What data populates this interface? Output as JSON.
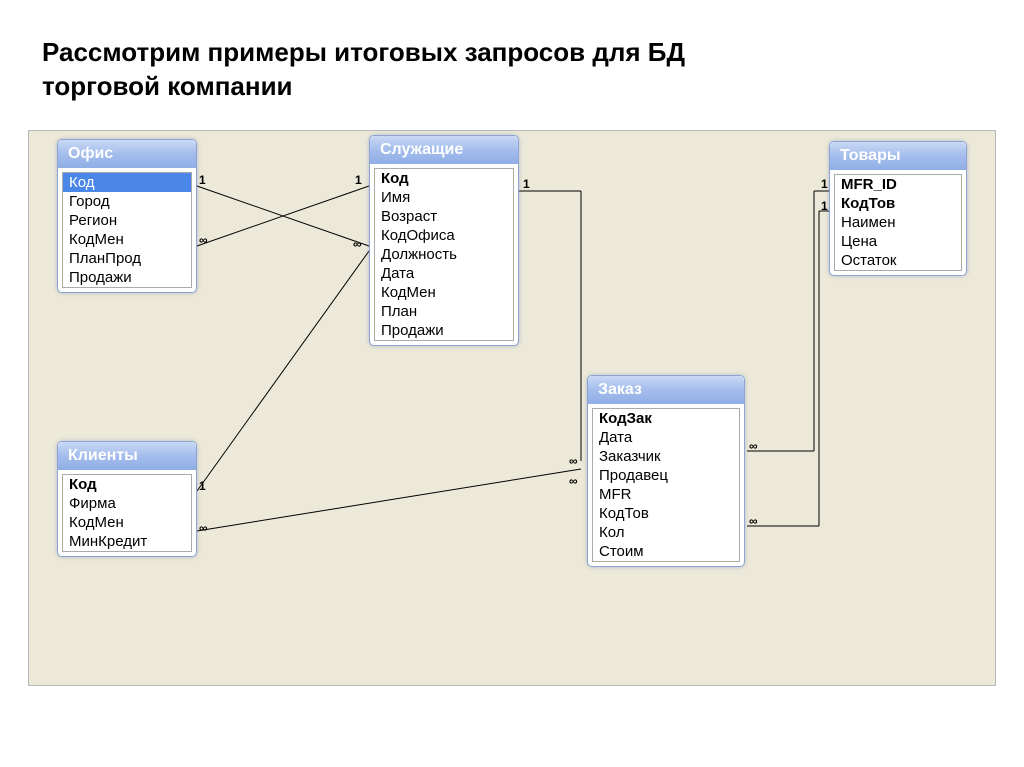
{
  "title_line1": "Рассмотрим примеры итоговых запросов для БД",
  "title_line2": "торговой компании",
  "entities": {
    "office": {
      "title": "Офис",
      "fields": [
        "Код",
        "Город",
        "Регион",
        "КодМен",
        "ПланПрод",
        "Продажи"
      ]
    },
    "employees": {
      "title": "Служащие",
      "fields": [
        "Код",
        "Имя",
        "Возраст",
        "КодОфиса",
        "Должность",
        "Дата",
        "КодМен",
        "План",
        "Продажи"
      ]
    },
    "clients": {
      "title": "Клиенты",
      "fields": [
        "Код",
        "Фирма",
        "КодМен",
        "МинКредит"
      ]
    },
    "order": {
      "title": "Заказ",
      "fields": [
        "КодЗак",
        "Дата",
        "Заказчик",
        "Продавец",
        "MFR",
        "КодТов",
        "Кол",
        "Стоим"
      ]
    },
    "products": {
      "title": "Товары",
      "fields": [
        "MFR_ID",
        "КодТов",
        "Наимен",
        "Цена",
        "Остаток"
      ]
    }
  },
  "relationships": {
    "one": "1",
    "many": "∞"
  }
}
